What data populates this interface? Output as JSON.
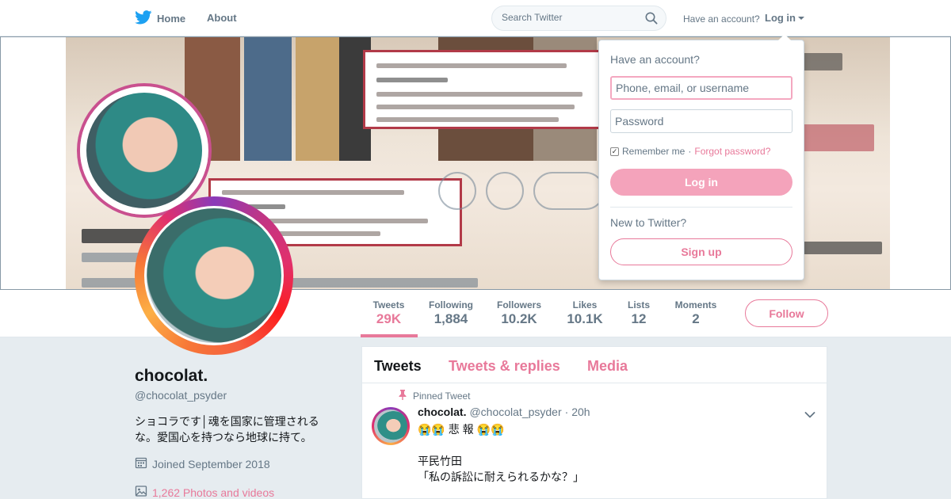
{
  "nav": {
    "home_label": "Home",
    "about_label": "About",
    "search_placeholder": "Search Twitter",
    "have_account": "Have an account?",
    "login_label": "Log in"
  },
  "login_dropdown": {
    "title": "Have an account?",
    "username_placeholder": "Phone, email, or username",
    "password_placeholder": "Password",
    "remember_me": "Remember me",
    "separator": "·",
    "forgot_password": "Forgot password?",
    "login_button": "Log in",
    "new_prompt": "New to Twitter?",
    "signup_button": "Sign up"
  },
  "stats": [
    {
      "label": "Tweets",
      "value": "29K"
    },
    {
      "label": "Following",
      "value": "1,884"
    },
    {
      "label": "Followers",
      "value": "10.2K"
    },
    {
      "label": "Likes",
      "value": "10.1K"
    },
    {
      "label": "Lists",
      "value": "12"
    },
    {
      "label": "Moments",
      "value": "2"
    }
  ],
  "follow_button": "Follow",
  "profile": {
    "name": "chocolat.",
    "handle": "@chocolat_psyder",
    "bio_line1": "ショコラです│魂を国家に管理される",
    "bio_line2": "な。愛国心を持つなら地球に持て。",
    "joined": "Joined September 2018",
    "photos": "1,262 Photos and videos"
  },
  "timeline": {
    "tabs": [
      "Tweets",
      "Tweets & replies",
      "Media"
    ],
    "pinned_label": "Pinned Tweet",
    "tweet": {
      "name": "chocolat.",
      "handle": "@chocolat_psyder",
      "time": "· 20h",
      "line1": "😭😭 悲 報 😭😭",
      "line2": "平民竹田",
      "line3": "「私の訴訟に耐えられるかな？」"
    }
  },
  "colors": {
    "accent": "#e8799a",
    "twitter_blue": "#1da1f2",
    "muted_text": "#657786"
  }
}
